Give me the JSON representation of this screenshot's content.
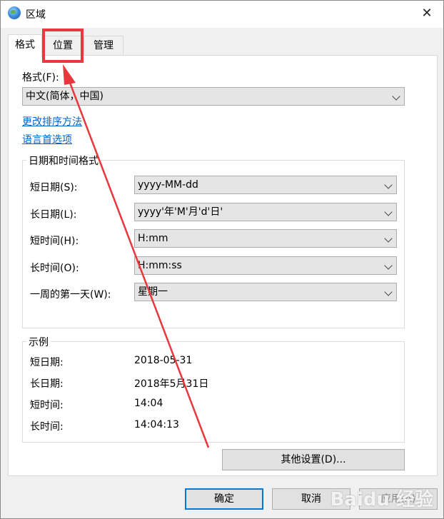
{
  "window": {
    "title": "区域",
    "close_glyph": "✕"
  },
  "tabs": [
    {
      "label": "格式",
      "active": true
    },
    {
      "label": "位置",
      "active": false
    },
    {
      "label": "管理",
      "active": false
    }
  ],
  "format": {
    "label": "格式(F):",
    "value": "中文(简体，中国)"
  },
  "links": {
    "change_sort": "更改排序方法",
    "language_prefs": "语言首选项"
  },
  "datetime_group": {
    "title": "日期和时间格式",
    "rows": [
      {
        "label": "短日期(S):",
        "value": "yyyy-MM-dd"
      },
      {
        "label": "长日期(L):",
        "value": "yyyy'年'M'月'd'日'"
      },
      {
        "label": "短时间(H):",
        "value": "H:mm"
      },
      {
        "label": "长时间(O):",
        "value": "H:mm:ss"
      },
      {
        "label": "一周的第一天(W):",
        "value": "星期一"
      }
    ]
  },
  "examples_group": {
    "title": "示例",
    "rows": [
      {
        "label": "短日期:",
        "value": "2018-05-31"
      },
      {
        "label": "长日期:",
        "value": "2018年5月31日"
      },
      {
        "label": "短时间:",
        "value": "14:04"
      },
      {
        "label": "长时间:",
        "value": "14:04:13"
      }
    ]
  },
  "buttons": {
    "other_settings": "其他设置(D)...",
    "ok": "确定",
    "cancel": "取消",
    "apply": "应用(A)"
  },
  "watermark": "Baidu 经验",
  "annotation_color": "#e8383d"
}
